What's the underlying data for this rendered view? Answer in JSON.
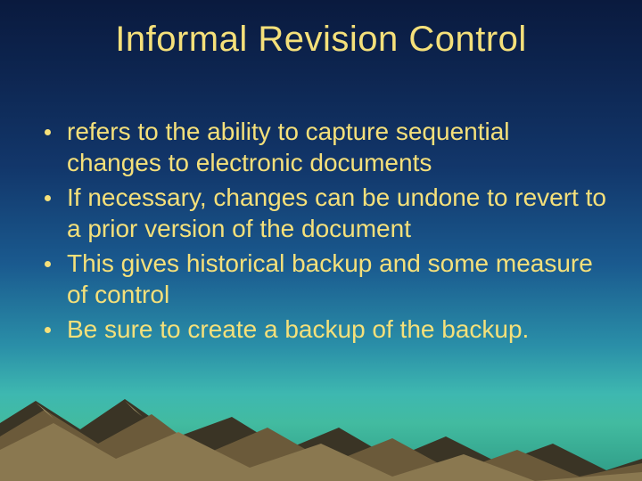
{
  "title": "Informal Revision Control",
  "bullets": [
    "refers to the ability to capture sequential changes to electronic documents",
    "If necessary, changes can be undone to revert to a prior version of the document",
    "This gives historical backup and some measure of control",
    "Be sure to create a backup of the backup."
  ]
}
